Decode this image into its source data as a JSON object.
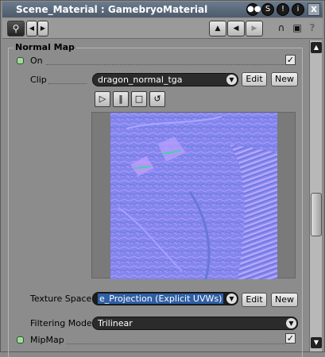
{
  "window": {
    "title": "Scene_Material : GamebryoMaterial",
    "close_label": "x"
  },
  "toolbar": {
    "nav_back": "◀",
    "nav_forward": "▶",
    "up_label": "▲",
    "left_label": "◀",
    "right_label": "▶",
    "help_label": "?"
  },
  "section": {
    "title": "Normal Map"
  },
  "fields": {
    "on_label": "On",
    "on_checked": true,
    "clip_label": "Clip",
    "clip_value": "dragon_normal_tga",
    "edit_label": "Edit",
    "new_label": "New",
    "texture_space_label": "Texture Space",
    "texture_space_value": "e_Projection (Explicit UVWs)",
    "filtering_mode_label": "Filtering Mode",
    "filtering_mode_value": "Trilinear",
    "mipmap_label": "MipMap",
    "mipmap_checked": true
  },
  "player": {
    "play": "▷",
    "pause": "‖",
    "stop": "□",
    "rewind": "↺"
  },
  "colors": {
    "normal_map_base": "#8080f0",
    "title_bar": "#5a6878",
    "led_green": "#a8d8a0"
  }
}
